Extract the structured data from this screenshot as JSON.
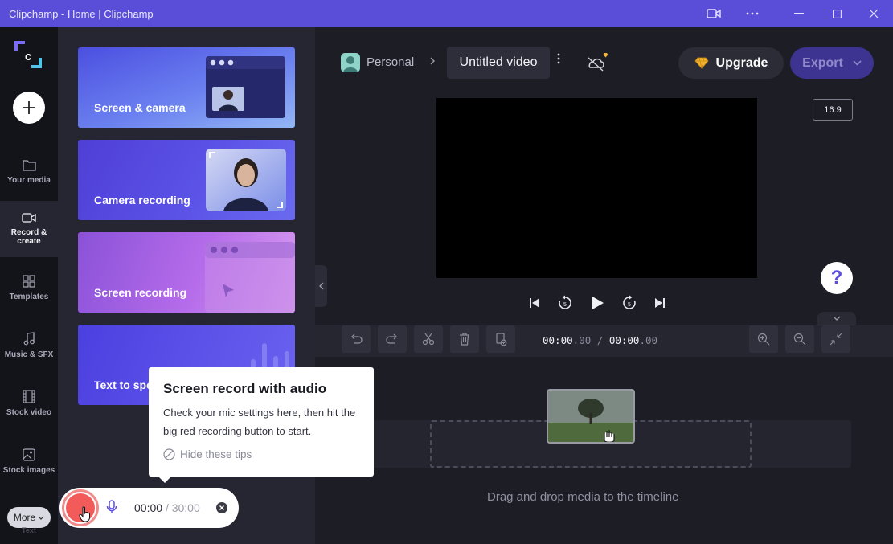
{
  "window": {
    "title": "Clipchamp - Home | Clipchamp"
  },
  "rail": {
    "items": [
      {
        "label": "Your media",
        "icon": "folder-icon"
      },
      {
        "label": "Record & create",
        "icon": "camera-icon"
      },
      {
        "label": "Templates",
        "icon": "templates-icon"
      },
      {
        "label": "Music & SFX",
        "icon": "music-note-icon"
      },
      {
        "label": "Stock video",
        "icon": "film-icon"
      },
      {
        "label": "Stock images",
        "icon": "image-icon"
      }
    ],
    "more_label": "More",
    "faded_label": "Text"
  },
  "panel": {
    "cards": [
      {
        "label": "Screen & camera"
      },
      {
        "label": "Camera recording"
      },
      {
        "label": "Screen recording"
      },
      {
        "label": "Text to spe"
      }
    ]
  },
  "header": {
    "workspace": "Personal",
    "video_title": "Untitled video",
    "upgrade_label": "Upgrade",
    "export_label": "Export"
  },
  "preview": {
    "aspect_ratio": "16:9",
    "help_label": "?"
  },
  "toolbar": {
    "time_current": "00:00",
    "time_current_frac": ".00",
    "time_sep": "/",
    "time_total": "00:00",
    "time_total_frac": ".00"
  },
  "timeline": {
    "drop_text": "Drag and drop media to the timeline"
  },
  "tooltip": {
    "title": "Screen record with audio",
    "body": "Check your mic settings here, then hit the big red recording button to start.",
    "hide_label": "Hide these tips"
  },
  "recorder": {
    "elapsed": "00:00",
    "limit": "/ 30:00"
  },
  "colors": {
    "titlebar": "#5a4ed8",
    "accent": "#5b4ee0",
    "record_red": "#f35a5a"
  }
}
